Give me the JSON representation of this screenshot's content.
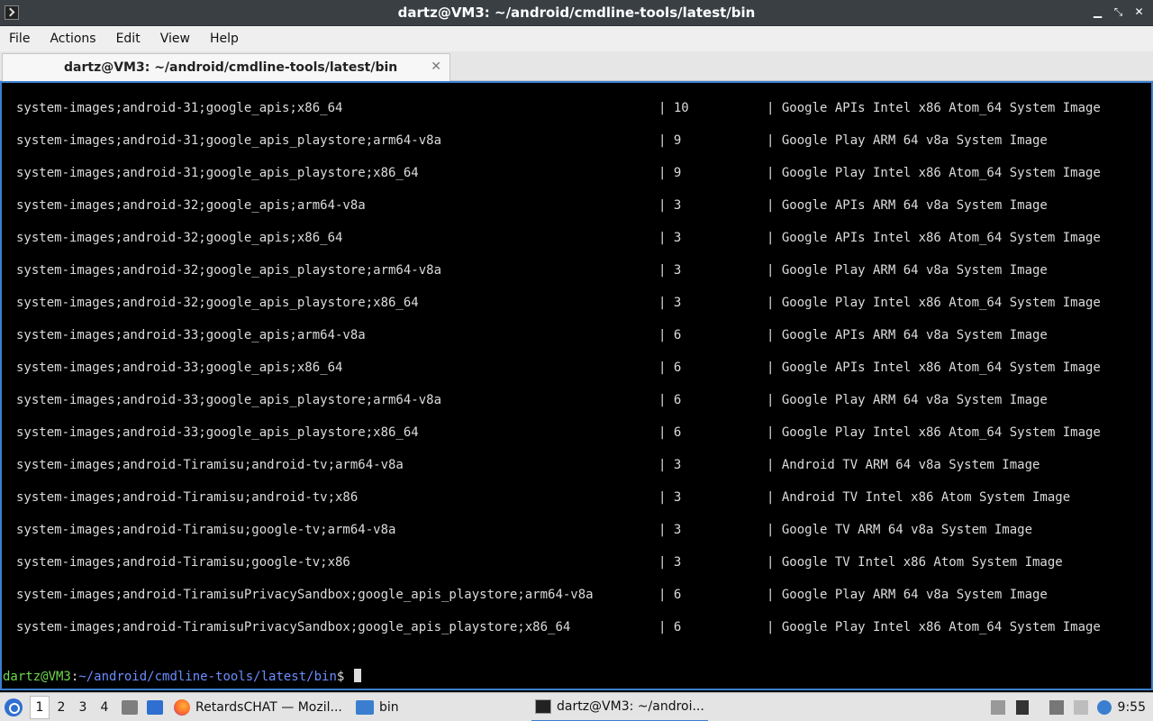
{
  "window": {
    "title": "dartz@VM3: ~/android/cmdline-tools/latest/bin",
    "controls": [
      "▁",
      "⤡",
      "✕"
    ]
  },
  "menubar": {
    "items": [
      "File",
      "Actions",
      "Edit",
      "View",
      "Help"
    ]
  },
  "tab": {
    "label": "dartz@VM3: ~/android/cmdline-tools/latest/bin",
    "close": "✕"
  },
  "terminal": {
    "rows": [
      {
        "pkg": "system-images;android-31;google_apis;x86_64",
        "ver": "| 10",
        "desc": "| Google APIs Intel x86 Atom_64 System Image"
      },
      {
        "pkg": "system-images;android-31;google_apis_playstore;arm64-v8a",
        "ver": "| 9",
        "desc": "| Google Play ARM 64 v8a System Image"
      },
      {
        "pkg": "system-images;android-31;google_apis_playstore;x86_64",
        "ver": "| 9",
        "desc": "| Google Play Intel x86 Atom_64 System Image"
      },
      {
        "pkg": "system-images;android-32;google_apis;arm64-v8a",
        "ver": "| 3",
        "desc": "| Google APIs ARM 64 v8a System Image"
      },
      {
        "pkg": "system-images;android-32;google_apis;x86_64",
        "ver": "| 3",
        "desc": "| Google APIs Intel x86 Atom_64 System Image"
      },
      {
        "pkg": "system-images;android-32;google_apis_playstore;arm64-v8a",
        "ver": "| 3",
        "desc": "| Google Play ARM 64 v8a System Image"
      },
      {
        "pkg": "system-images;android-32;google_apis_playstore;x86_64",
        "ver": "| 3",
        "desc": "| Google Play Intel x86 Atom_64 System Image"
      },
      {
        "pkg": "system-images;android-33;google_apis;arm64-v8a",
        "ver": "| 6",
        "desc": "| Google APIs ARM 64 v8a System Image"
      },
      {
        "pkg": "system-images;android-33;google_apis;x86_64",
        "ver": "| 6",
        "desc": "| Google APIs Intel x86 Atom_64 System Image"
      },
      {
        "pkg": "system-images;android-33;google_apis_playstore;arm64-v8a",
        "ver": "| 6",
        "desc": "| Google Play ARM 64 v8a System Image"
      },
      {
        "pkg": "system-images;android-33;google_apis_playstore;x86_64",
        "ver": "| 6",
        "desc": "| Google Play Intel x86 Atom_64 System Image"
      },
      {
        "pkg": "system-images;android-Tiramisu;android-tv;arm64-v8a",
        "ver": "| 3",
        "desc": "| Android TV ARM 64 v8a System Image"
      },
      {
        "pkg": "system-images;android-Tiramisu;android-tv;x86",
        "ver": "| 3",
        "desc": "| Android TV Intel x86 Atom System Image"
      },
      {
        "pkg": "system-images;android-Tiramisu;google-tv;arm64-v8a",
        "ver": "| 3",
        "desc": "| Google TV ARM 64 v8a System Image"
      },
      {
        "pkg": "system-images;android-Tiramisu;google-tv;x86",
        "ver": "| 3",
        "desc": "| Google TV Intel x86 Atom System Image"
      },
      {
        "pkg": "system-images;android-TiramisuPrivacySandbox;google_apis_playstore;arm64-v8a",
        "ver": "| 6",
        "desc": "| Google Play ARM 64 v8a System Image"
      },
      {
        "pkg": "system-images;android-TiramisuPrivacySandbox;google_apis_playstore;x86_64",
        "ver": "| 6",
        "desc": "| Google Play Intel x86 Atom_64 System Image"
      }
    ],
    "prompt": {
      "user": "dartz@VM3",
      "sep": ":",
      "path": "~/android/cmdline-tools/latest/bin",
      "dollar": "$ "
    },
    "colors": {
      "user": "#6fd84a",
      "path": "#6b8dff",
      "text": "#dcdcdc"
    }
  },
  "taskbar": {
    "workspaces": [
      "1",
      "2",
      "3",
      "4"
    ],
    "tasks": [
      {
        "label": "RetardsCHAT — Mozil...",
        "icon": "firefox-icon"
      },
      {
        "label": "bin",
        "icon": "folder-icon"
      },
      {
        "label": "dartz@VM3: ~/androi...",
        "icon": "terminal-icon"
      }
    ],
    "clock": "9:55"
  }
}
